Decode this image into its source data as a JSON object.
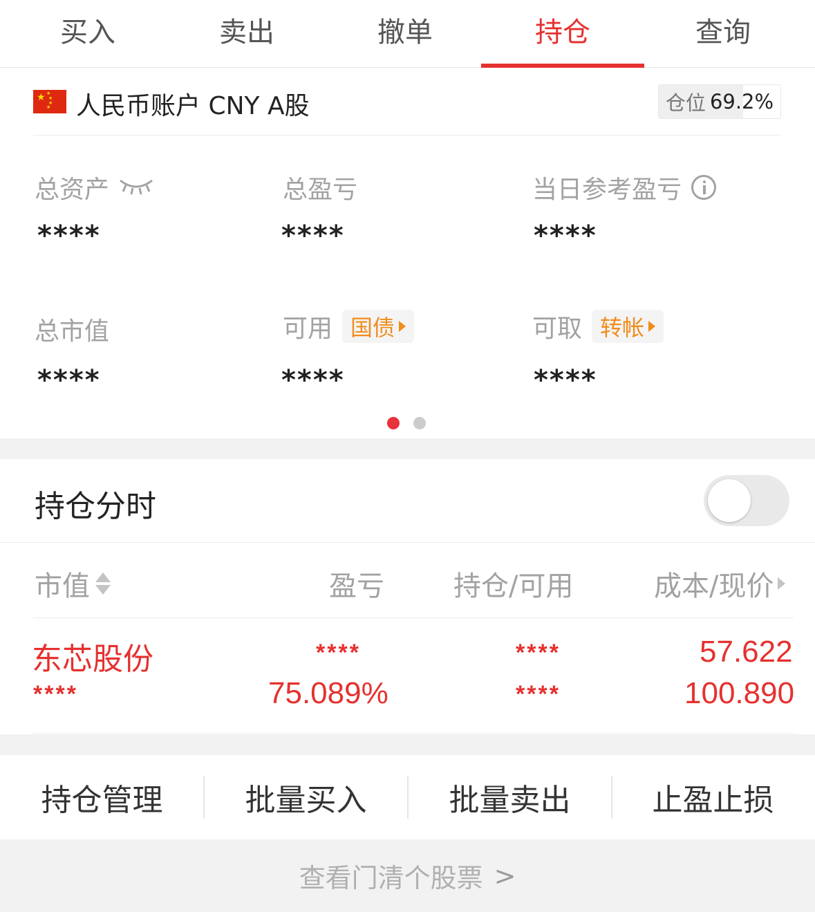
{
  "tabs": [
    {
      "label": "买入"
    },
    {
      "label": "卖出"
    },
    {
      "label": "撤单"
    },
    {
      "label": "持仓"
    },
    {
      "label": "查询"
    }
  ],
  "active_tab": "持仓",
  "account": {
    "title": "人民币账户 CNY A股",
    "position_label": "仓位",
    "position_value": "69.2%",
    "position_fraction": 0.692
  },
  "stats": {
    "total_assets_label": "总资产",
    "total_assets_value": "****",
    "total_pnl_label": "总盈亏",
    "total_pnl_value": "****",
    "daily_pnl_label": "当日参考盈亏",
    "daily_pnl_value": "****",
    "market_value_label": "总市值",
    "market_value_value": "****",
    "available_label": "可用",
    "available_chip": "国债",
    "available_value": "****",
    "withdrawable_label": "可取",
    "withdrawable_chip": "转帐",
    "withdrawable_value": "****"
  },
  "pager": {
    "pages": 2,
    "active": 1
  },
  "holding": {
    "title": "持仓分时",
    "toggle_on": false,
    "columns": [
      "市值",
      "盈亏",
      "持仓/可用",
      "成本/现价"
    ],
    "rows": [
      {
        "name": "东芯股份",
        "market_value": "****",
        "pnl": "****",
        "pnl_pct": "75.089%",
        "position": "****",
        "available": "****",
        "cost": "57.622",
        "price": "100.890"
      }
    ]
  },
  "actions": [
    "持仓管理",
    "批量买入",
    "批量卖出",
    "止盈止损"
  ],
  "footer": {
    "label": "查看门清个股票",
    "arrow": ">"
  },
  "colors": {
    "accent": "#e5312f",
    "chip": "#f08c1c",
    "muted": "#a2a2a2",
    "flag": "#de2910"
  }
}
